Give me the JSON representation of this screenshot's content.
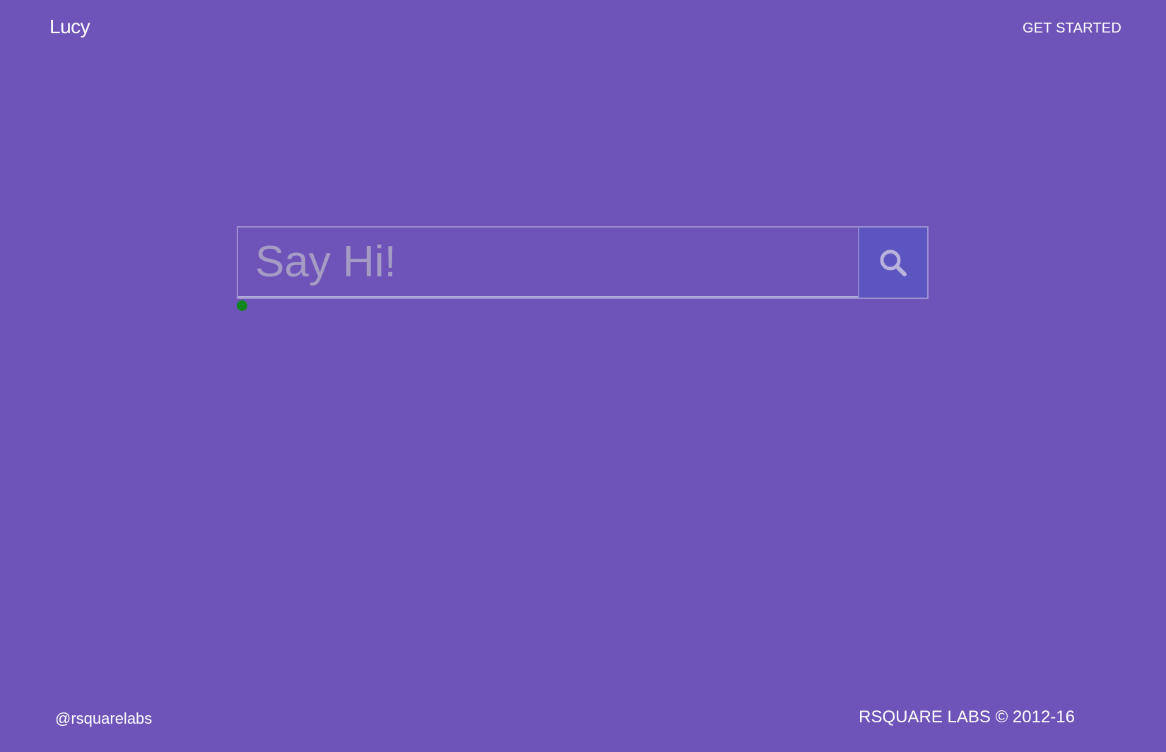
{
  "header": {
    "brand": "Lucy",
    "cta_label": "GET STARTED"
  },
  "search": {
    "placeholder": "Say Hi!",
    "button_icon": "search-icon"
  },
  "status": {
    "indicator_color": "#12861c"
  },
  "footer": {
    "handle": "@rsquarelabs",
    "copyright": "RSQUARE LABS © 2012-16"
  },
  "colors": {
    "background": "#6e54b8",
    "button": "#5d55bf"
  }
}
